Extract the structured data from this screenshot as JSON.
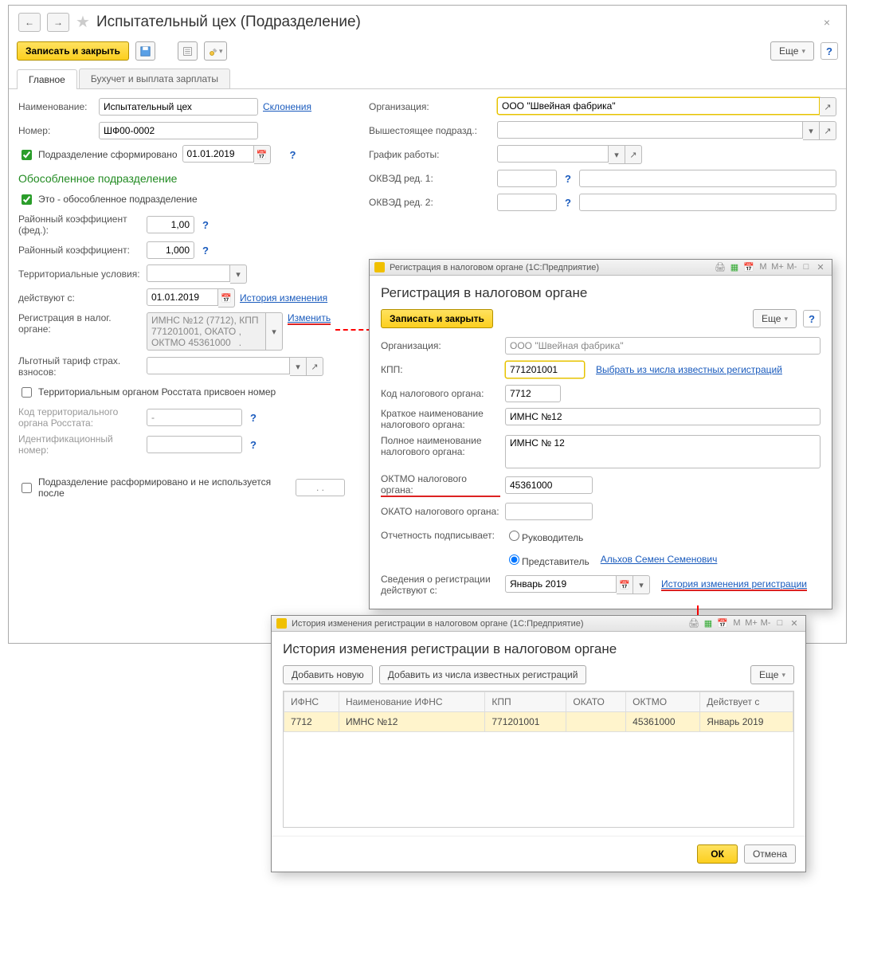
{
  "main": {
    "title": "Испытательный цех (Подразделение)",
    "toolbar": {
      "save_close": "Записать и закрыть",
      "more": "Еще"
    },
    "tabs": {
      "main": "Главное",
      "payroll": "Бухучет и выплата зарплаты"
    },
    "left": {
      "name_lbl": "Наименование:",
      "name": "Испытательный цех",
      "declension": "Склонения",
      "number_lbl": "Номер:",
      "number": "ШФ00-0002",
      "formed_chk": "Подразделение сформировано",
      "formed_date": "01.01.2019",
      "section": "Обособленное подразделение",
      "separate_chk": "Это - обособленное подразделение",
      "coef_fed_lbl": "Районный коэффициент (фед.):",
      "coef_fed": "1,00",
      "coef_lbl": "Районный коэффициент:",
      "coef": "1,000",
      "terr_lbl": "Территориальные условия:",
      "valid_from_lbl": "действуют с:",
      "valid_from": "01.01.2019",
      "history_link": "История изменения",
      "tax_reg_lbl": "Регистрация в налог. органе:",
      "tax_reg": "ИМНС №12 (7712), КПП 771201001, ОКАТО , ОКТМО 45361000   .",
      "change": "Изменить",
      "tariff_lbl": "Льготный тариф страх. взносов:",
      "rosstat_chk": "Территориальным органом Росстата присвоен номер",
      "rosstat_code_lbl": "Код территориального органа Росстата:",
      "rosstat_code": "- ",
      "ident_lbl": "Идентификационный номер:",
      "disbanded_lbl": "Подразделение расформировано и не используется после",
      "disbanded_date": ". ."
    },
    "right": {
      "org_lbl": "Организация:",
      "org": "ООО \"Швейная фабрика\"",
      "parent_lbl": "Вышестоящее подразд.:",
      "schedule_lbl": "График работы:",
      "okved1_lbl": "ОКВЭД ред. 1:",
      "okved2_lbl": "ОКВЭД ред. 2:"
    }
  },
  "reg": {
    "wintitle": "Регистрация в налоговом органе  (1С:Предприятие)",
    "heading": "Регистрация в налоговом органе",
    "save_close": "Записать и закрыть",
    "more": "Еще",
    "org_lbl": "Организация:",
    "org": "ООО \"Швейная фабрика\"",
    "kpp_lbl": "КПП:",
    "kpp": "771201001",
    "known_link": "Выбрать из числа известных регистраций",
    "code_lbl": "Код налогового органа:",
    "code": "7712",
    "short_lbl": "Краткое наименование налогового органа:",
    "short": "ИМНС №12",
    "full_lbl": "Полное наименование налогового органа:",
    "full": "ИМНС № 12",
    "oktmo_lbl": "ОКТМО налогового органа:",
    "oktmo": "45361000",
    "okato_lbl": "ОКАТО налогового органа:",
    "sign_lbl": "Отчетность подписывает:",
    "sign_opt1": "Руководитель",
    "sign_opt2": "Представитель",
    "rep_link": "Альхов Семен Семенович",
    "valid_lbl": "Сведения о регистрации действуют с:",
    "valid": "Январь 2019",
    "hist_link": "История изменения регистрации"
  },
  "hist": {
    "wintitle": "История изменения регистрации в налоговом органе  (1С:Предприятие)",
    "heading": "История изменения регистрации в налоговом органе",
    "add_new": "Добавить новую",
    "add_known": "Добавить из числа известных регистраций",
    "more": "Еще",
    "cols": {
      "ifns": "ИФНС",
      "name": "Наименование ИФНС",
      "kpp": "КПП",
      "okato": "ОКАТО",
      "oktmo": "ОКТМО",
      "valid": "Действует с"
    },
    "row": {
      "ifns": "7712",
      "name": "ИМНС №12",
      "kpp": "771201001",
      "okato": "",
      "oktmo": "45361000",
      "valid": "Январь 2019"
    },
    "ok": "ОК",
    "cancel": "Отмена"
  },
  "winctrl": {
    "m": "M",
    "mp": "M+",
    "mm": "M-"
  }
}
